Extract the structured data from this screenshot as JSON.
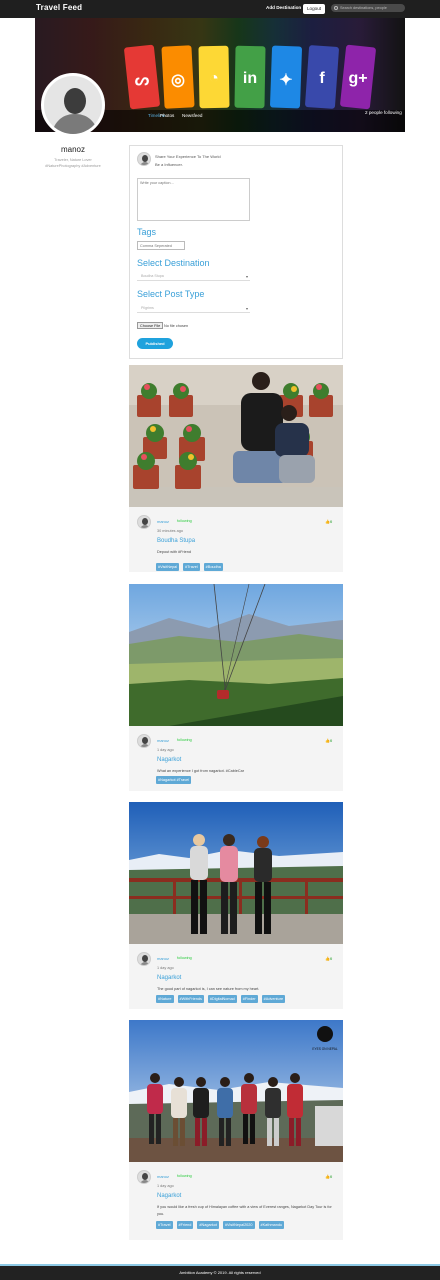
{
  "navbar": {
    "brand": "Travel Feed",
    "add_destination": "Add Destination",
    "logout": "Logout",
    "search_placeholder": "Search destinations, people"
  },
  "cover": {
    "tabs": [
      "Timeline",
      "Photos",
      "Newsfeed"
    ],
    "following": "2 people following",
    "crayon_colors": [
      "#e53935",
      "#fb8c00",
      "#fdd835",
      "#43a047",
      "#1e88e5",
      "#3949ab",
      "#8e24aa"
    ],
    "crayon_icons": [
      "stumbleupon-icon",
      "instagram-icon",
      "rss-icon",
      "linkedin-icon",
      "twitter-icon",
      "facebook-icon",
      "google-plus-icon"
    ]
  },
  "profile": {
    "name": "manoz",
    "bio_line1": "Traveler, Nature Lover",
    "bio_line2": "#NaturePhotography #Adventure"
  },
  "compose": {
    "share_line1": "Share Your Experience To The World",
    "share_line2": "Be a Influencer.",
    "caption_placeholder": "Write your caption...",
    "tags_title": "Tags",
    "tags_placeholder": "Comma Seperated",
    "destination_title": "Select Destination",
    "destination_value": "Boudha Stupa",
    "post_type_title": "Select Post Type",
    "post_type_value": "Pilgrims",
    "file_button": "Choose File",
    "file_status": "No file chosen",
    "publish": "Published"
  },
  "posts": [
    {
      "author": "manoz",
      "follow": "following",
      "time": "30 minutes ago",
      "like": "0",
      "destination": "Boudha Stupa",
      "description": "Depout with #Friend",
      "tags": [
        "#VisitNepal",
        "#Travel",
        "#Boudha"
      ]
    },
    {
      "author": "manoz",
      "follow": "following",
      "time": "1 day ago",
      "like": "0",
      "destination": "Nagarkot",
      "description": "What an experience I got from nagarkot. #CableCar",
      "tags": [
        "#Nagarkot #Travel"
      ]
    },
    {
      "author": "manoz",
      "follow": "following",
      "time": "1 day ago",
      "like": "0",
      "destination": "Nagarkot",
      "description": "The good part of nagarkot is, I can see nature from my heart.",
      "tags": [
        "#Nature",
        "#WithFriends",
        "#DigitalNomad",
        "#Finder",
        "#Adventure"
      ]
    },
    {
      "author": "manoz",
      "follow": "following",
      "time": "1 day ago",
      "like": "0",
      "destination": "Nagarkot",
      "description": "If you would like a fresh cup of Himalayan coffee with a view of Everest ranges, Nagarkot Day Tour is for you.",
      "tags": [
        "#Travel",
        "#Friend",
        "#Nagarkot",
        "#VisitNepal2020",
        "#Kathmandu"
      ],
      "watermark": "EYES ON NEPAL"
    }
  ],
  "footer": "Ambition Academy © 2019. All rights reserved"
}
